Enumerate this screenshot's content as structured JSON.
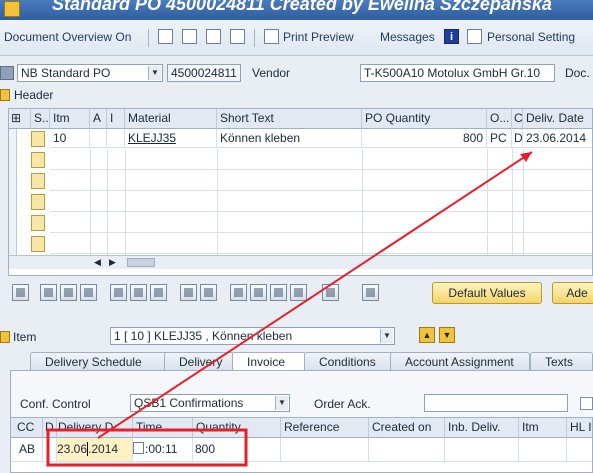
{
  "window": {
    "title": "Standard PO 4500024811 Created by Ewelina Szczepanska"
  },
  "toolbar": {
    "document_overview": "Document Overview On",
    "print_preview": "Print Preview",
    "messages": "Messages",
    "personal_setting": "Personal Setting"
  },
  "header_row": {
    "doc_type": "NB Standard PO",
    "po_number": "4500024811",
    "vendor_label": "Vendor",
    "vendor_value": "T-K500A10 Motolux GmbH Gr.10",
    "doc_date_label": "Doc."
  },
  "header_section": {
    "label": "Header"
  },
  "items_table": {
    "columns": [
      "S..",
      "Itm",
      "A",
      "I",
      "Material",
      "Short Text",
      "PO Quantity",
      "O...",
      "C",
      "Deliv. Date"
    ],
    "rows": [
      {
        "itm": "10",
        "material": "KLEJJ35",
        "short_text": "Können kleben",
        "po_qty": "800",
        "unit": "PC",
        "c": "D",
        "deliv_date": "23.06.2014"
      }
    ]
  },
  "item_actions": {
    "default_values": "Default Values",
    "addl": "Ade"
  },
  "item_section": {
    "label": "Item",
    "selected": "1 [ 10 ] KLEJJ35 , Können kleben"
  },
  "tabs": [
    "Delivery Schedule",
    "Delivery",
    "Invoice",
    "Conditions",
    "Account Assignment",
    "Texts"
  ],
  "confirmations": {
    "conf_control_label": "Conf. Control",
    "conf_control_value": "QSB1 Confirmations",
    "order_ack_label": "Order Ack.",
    "order_ack_value": "",
    "columns": [
      "CC",
      "D",
      "Delivery D...",
      "Time",
      "Quantity",
      "Reference",
      "Created on",
      "Inb. Deliv.",
      "Itm",
      "HL It"
    ],
    "rows": [
      {
        "cc": "AB",
        "delivery_date_prefix": "23.06",
        "delivery_date_suffix": ".2014",
        "time": ":00:11",
        "quantity": "800"
      }
    ]
  },
  "colors": {
    "annotation": "#e5202a",
    "title_bar": "#2f5e9e",
    "accent_button": "#f3d46a"
  }
}
